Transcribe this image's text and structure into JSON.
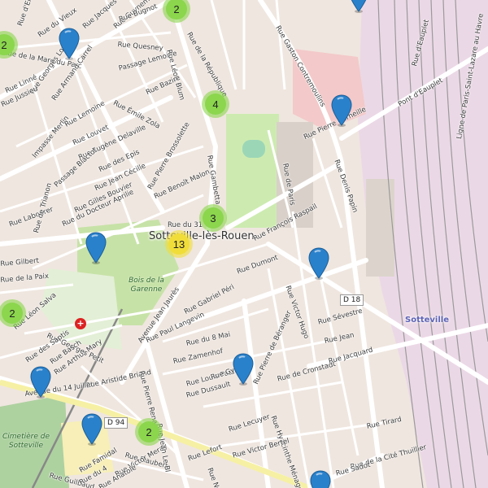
{
  "map": {
    "place_name": "Sotteville-lès-Rouen",
    "station_name": "Sotteville",
    "road_refs": [
      "D 18",
      "D 94"
    ],
    "parks": {
      "garenne": "Bois de la Garenne",
      "cemetery": "Cimetière de Sotteville"
    },
    "streets": [
      "Rue d'Elbeuf",
      "Rue du Vieux",
      "Rue de la Mare du Parc",
      "Rue Jacques Duclos",
      "Rue Guynemer",
      "Rue Bugnot",
      "Rue Quesney",
      "Passage Lemoine",
      "Rue Léon Blum",
      "Rue de la République",
      "Rue Pierre Corneille",
      "Rue Gaston Contremoulins",
      "Rue d'Eauplet",
      "Pont d'Eauplet",
      "Ligne de Paris-Saint-Lazare au Havre",
      "Rue Denis Papin",
      "Rue de Paris",
      "Rue François Raspail",
      "Rue Dumont",
      "Rue Gabriel Péri",
      "Avenue Jean Jaurès",
      "Rue Paul Langevin",
      "Rue du 8 Mai",
      "Rue Zamenhof",
      "Rue Louis Pasteur",
      "Rue Dussault",
      "Rue Pierre de Béranger",
      "Rue de Cronstadt",
      "Rue Jacquard",
      "Rue Jean",
      "Rue Sévestre",
      "Rue Victor Hugo",
      "Rue Hyacinthe Ménagé",
      "Rue Lecuyer",
      "Rue Victor Bertel",
      "Rue Tirard",
      "Rue de la Cité Thuillier",
      "Rue Flaubert",
      "Rue Aristide Briand",
      "Rue Pierre Renaudel",
      "Avenue du 14 Juillet",
      "Rue Arthur Mary",
      "Rue Georges Petit",
      "Rue Léon Salva",
      "Rue Gilbert",
      "Rue de la Paix",
      "Rue Labourer",
      "Rue de Trianon",
      "Rue du Docteur Aprilie",
      "Rue Gilles Bouvier",
      "Rue Jean Cécille",
      "Rue des Epis",
      "Rue Eugène Delaville",
      "Rue Louvet",
      "Passage Blactot",
      "Impasse Merlin",
      "Rue Lemoine",
      "Rue Armand Carrel",
      "Rue Georges Lowe",
      "Rue Linné",
      "Rue Jussieu",
      "Rue Émile Zola",
      "Rue Bazire",
      "Rue Benoît Malon",
      "Rue du 31",
      "Rue Gambetta",
      "Rue Pierre Brossolette",
      "Rue Gy",
      "Rue Sadot",
      "Rue Guilbaud",
      "Rue Victor Meray",
      "Rue des Saptis",
      "Rue Basch",
      "Rue du 4",
      "Rue Famidal",
      "Rue Anatole",
      "Rue Jean Le Bl",
      "Rue Lefort",
      "Rue Noël"
    ],
    "clusters": [
      {
        "id": "c1",
        "count": "2",
        "color": "#8bd64d"
      },
      {
        "id": "c2",
        "count": "2",
        "color": "#8bd64d"
      },
      {
        "id": "c3",
        "count": "4",
        "color": "#8bd64d"
      },
      {
        "id": "c4",
        "count": "3",
        "color": "#8bd64d"
      },
      {
        "id": "c5",
        "count": "13",
        "color": "#f0dd3a"
      },
      {
        "id": "c6",
        "count": "2",
        "color": "#8bd64d"
      },
      {
        "id": "c7",
        "count": "2",
        "color": "#8bd64d"
      }
    ],
    "marker_color": "#2a81cb",
    "marker_count": 9
  }
}
